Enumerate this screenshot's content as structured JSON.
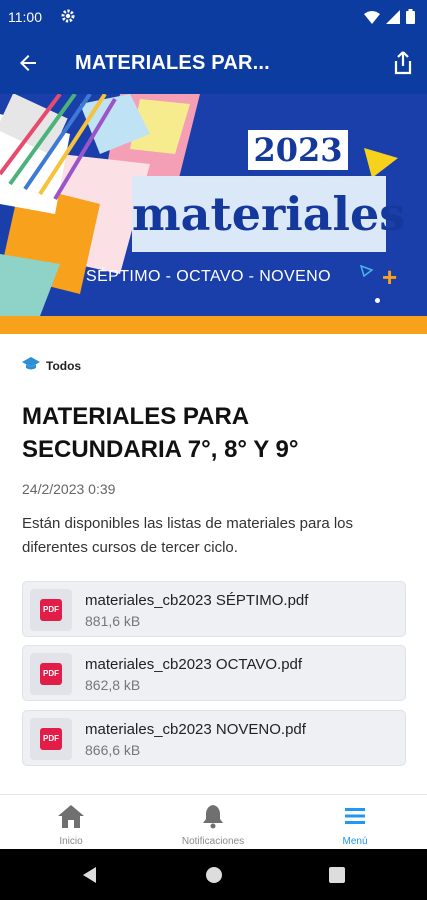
{
  "status": {
    "time": "11:00"
  },
  "appbar": {
    "title": "MATERIALES PAR..."
  },
  "banner": {
    "year": "2023",
    "word": "materiales",
    "grades": "SÉPTIMO - OCTAVO - NOVENO"
  },
  "post": {
    "category": "Todos",
    "title": "MATERIALES PARA SECUNDARIA 7°, 8° Y 9°",
    "date": "24/2/2023 0:39",
    "body": "Están disponibles las listas de materiales para los diferentes cursos de tercer ciclo."
  },
  "attachments": [
    {
      "icon": "pdf-icon",
      "badge": "PDF",
      "name": "materiales_cb2023 SÉPTIMO.pdf",
      "size": "881,6 kB"
    },
    {
      "icon": "pdf-icon",
      "badge": "PDF",
      "name": "materiales_cb2023 OCTAVO.pdf",
      "size": "862,8 kB"
    },
    {
      "icon": "pdf-icon",
      "badge": "PDF",
      "name": "materiales_cb2023 NOVENO.pdf",
      "size": "866,6 kB"
    }
  ],
  "nav": {
    "items": [
      {
        "label": "Inicio",
        "icon": "home-icon"
      },
      {
        "label": "Notificaciones",
        "icon": "bell-icon"
      },
      {
        "label": "Menú",
        "icon": "menu-icon",
        "active": true
      }
    ]
  },
  "colors": {
    "primary": "#0d3ca0",
    "accent": "#f7a11c",
    "pdf": "#e11d48",
    "active": "#2196f3"
  }
}
